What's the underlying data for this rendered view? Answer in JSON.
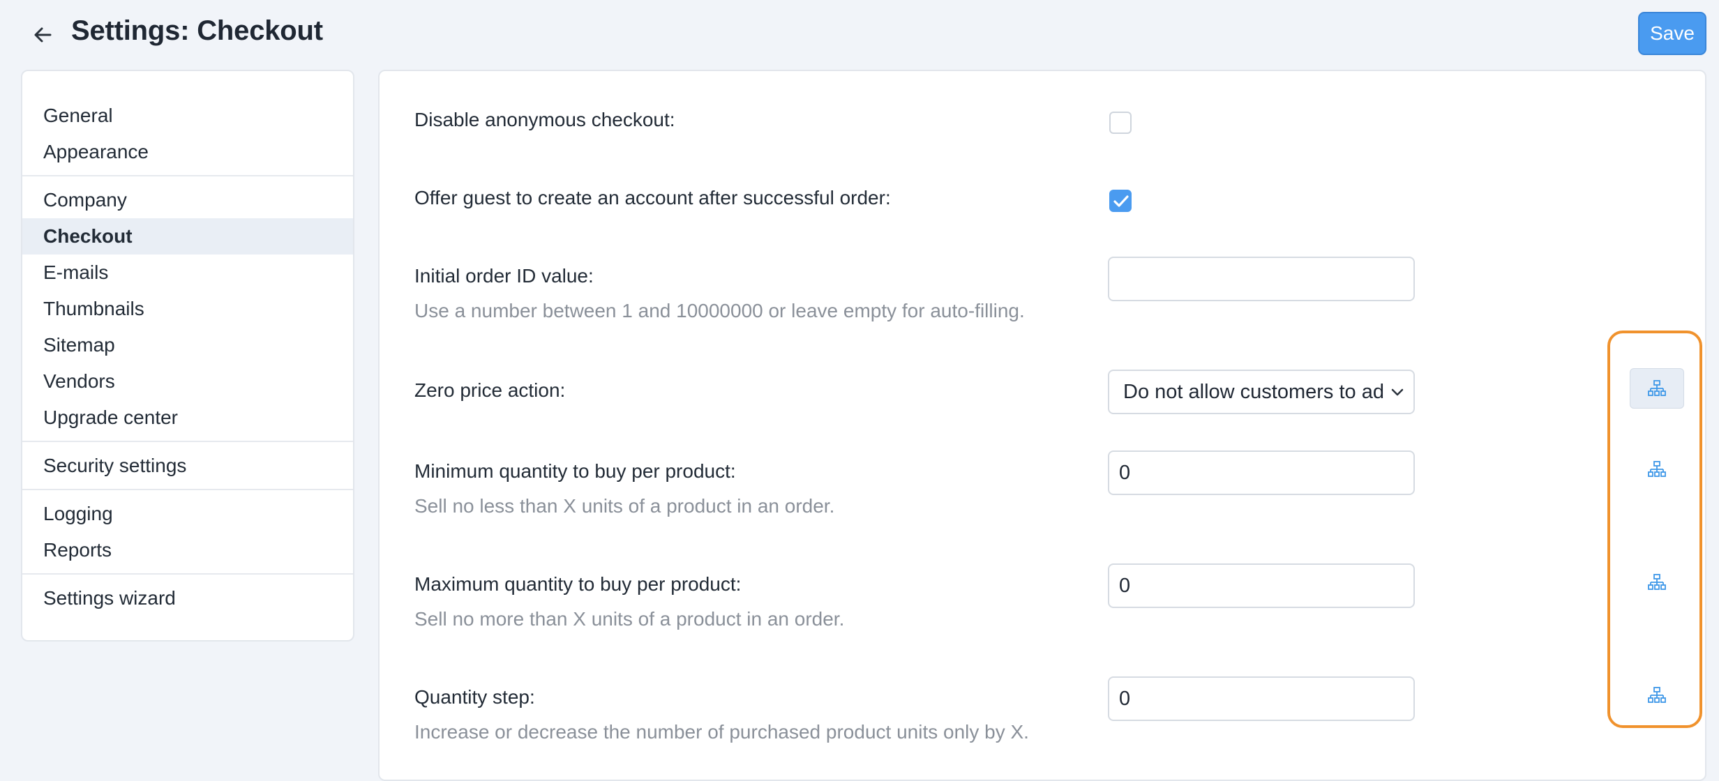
{
  "header": {
    "title": "Settings: Checkout",
    "back_icon": "arrow-left-icon",
    "save_label": "Save"
  },
  "sidebar": {
    "groups": [
      {
        "items": [
          {
            "label": "General"
          },
          {
            "label": "Appearance"
          }
        ]
      },
      {
        "items": [
          {
            "label": "Company"
          },
          {
            "label": "Checkout",
            "active": true
          },
          {
            "label": "E-mails"
          },
          {
            "label": "Thumbnails"
          },
          {
            "label": "Sitemap"
          },
          {
            "label": "Vendors"
          },
          {
            "label": "Upgrade center"
          }
        ]
      },
      {
        "items": [
          {
            "label": "Security settings"
          }
        ]
      },
      {
        "items": [
          {
            "label": "Logging"
          },
          {
            "label": "Reports"
          }
        ]
      },
      {
        "items": [
          {
            "label": "Settings wizard"
          }
        ]
      }
    ]
  },
  "settings": {
    "disable_anonymous": {
      "label": "Disable anonymous checkout:",
      "checked": false
    },
    "offer_guest_account": {
      "label": "Offer guest to create an account after successful order:",
      "checked": true
    },
    "initial_order_id": {
      "label": "Initial order ID value:",
      "hint": "Use a number between 1 and 10000000 or leave empty for auto-filling.",
      "value": ""
    },
    "zero_price_action": {
      "label": "Zero price action:",
      "value": "Do not allow customers to add"
    },
    "min_qty": {
      "label": "Minimum quantity to buy per product:",
      "hint": "Sell no less than X units of a product in an order.",
      "value": "0"
    },
    "max_qty": {
      "label": "Maximum quantity to buy per product:",
      "hint": "Sell no more than X units of a product in an order.",
      "value": "0"
    },
    "qty_step": {
      "label": "Quantity step:",
      "hint": "Increase or decrease the number of purchased product units only by X.",
      "value": "0"
    }
  },
  "vendor_icon": "hierarchy-sitemap-icon",
  "colors": {
    "accent": "#4a9bf0",
    "highlight": "#f0922d",
    "background": "#f1f4f9"
  }
}
